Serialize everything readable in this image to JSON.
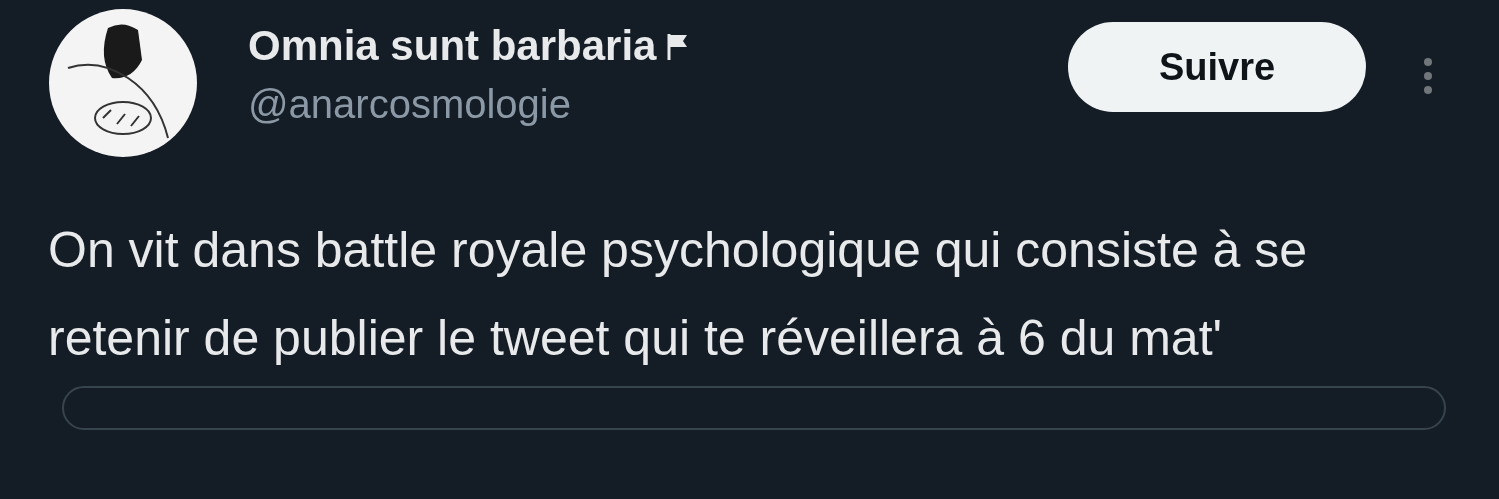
{
  "author": {
    "name": "Omnia sunt barbaria",
    "handle": "@anarcosmologie"
  },
  "follow_button": {
    "label": "Suivre"
  },
  "tweet": {
    "text": "On vit dans battle royale psychologique qui consiste à se retenir de publier le tweet qui te réveillera à 6 du mat'"
  }
}
